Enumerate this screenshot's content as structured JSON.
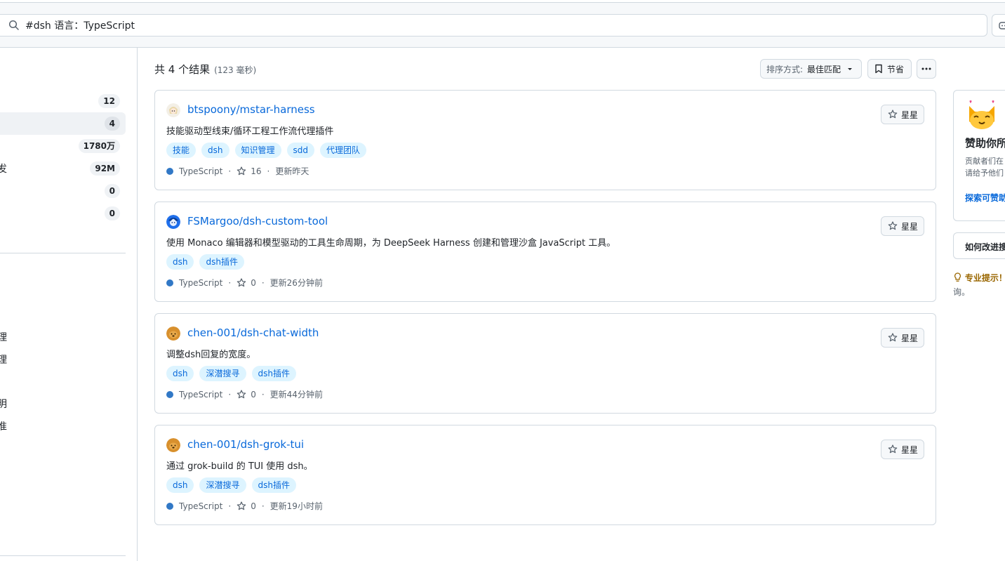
{
  "search": {
    "query": "#dsh 语言：TypeScript"
  },
  "sidebar": {
    "filters": [
      {
        "lead": "",
        "count": "12",
        "selected": false
      },
      {
        "lead": "",
        "count": "4",
        "selected": true
      },
      {
        "lead": "",
        "count": "1780万",
        "selected": false
      },
      {
        "lead": "发",
        "count": "92M",
        "selected": false
      },
      {
        "lead": "",
        "count": "0",
        "selected": false
      },
      {
        "lead": "",
        "count": "0",
        "selected": false
      }
    ],
    "fragments": [
      "理",
      "理",
      "明",
      "准"
    ]
  },
  "results": {
    "summary": "共 4 个结果",
    "time": "(123 毫秒)",
    "sort_label": "排序方式:",
    "sort_value": "最佳匹配",
    "save_label": "节省"
  },
  "repos": [
    {
      "name": "btspoony/mstar-harness",
      "description": "技能驱动型线束/循环工程工作流代理插件",
      "topics": [
        "技能",
        "dsh",
        "知识管理",
        "sdd",
        "代理团队"
      ],
      "language": "TypeScript",
      "stars": "16",
      "updated": "更新昨天",
      "star_label": "星星"
    },
    {
      "name": "FSMargoo/dsh-custom-tool",
      "description": "使用 Monaco 编辑器和模型驱动的工具生命周期，为 DeepSeek Harness 创建和管理沙盒 JavaScript 工具。",
      "topics": [
        "dsh",
        "dsh插件"
      ],
      "language": "TypeScript",
      "stars": "0",
      "updated": "更新26分钟前",
      "star_label": "星星"
    },
    {
      "name": "chen-001/dsh-chat-width",
      "description": "调整dsh回复的宽度。",
      "topics": [
        "dsh",
        "深潜搜寻",
        "dsh插件"
      ],
      "language": "TypeScript",
      "stars": "0",
      "updated": "更新44分钟前",
      "star_label": "星星"
    },
    {
      "name": "chen-001/dsh-grok-tui",
      "description": "通过 grok-build 的 TUI 使用 dsh。",
      "topics": [
        "dsh",
        "深潜搜寻",
        "dsh插件"
      ],
      "language": "TypeScript",
      "stars": "0",
      "updated": "更新19小时前",
      "star_label": "星星"
    }
  ],
  "right": {
    "sponsor_title": "赞助你所",
    "sponsor_line1": "贡献者们在",
    "sponsor_line2": "请给予他们",
    "sponsor_link": "探索可赞助",
    "improve": "如何改进搜",
    "protip_label": "专业提示！",
    "protip_cont": "询。"
  },
  "colors": {
    "accent": "#0969da",
    "typescript": "#3178c6",
    "topic_bg": "#ddf4ff"
  }
}
